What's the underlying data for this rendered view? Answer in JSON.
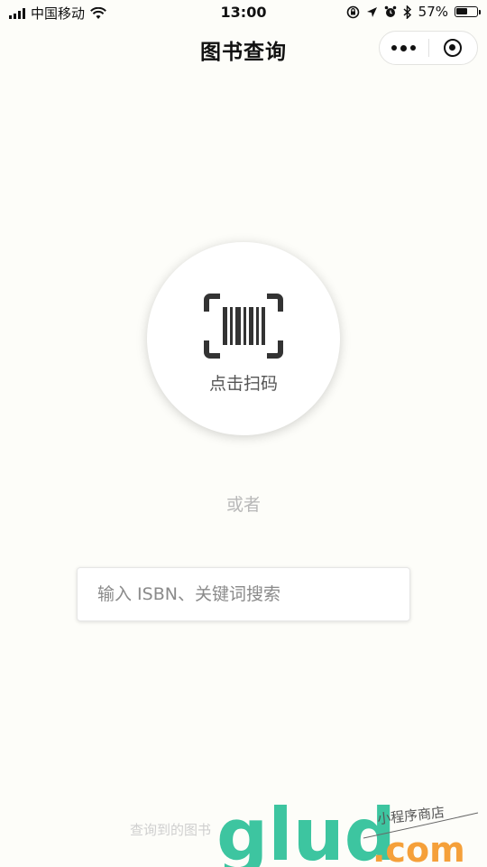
{
  "status_bar": {
    "carrier": "中国移动",
    "time": "13:00",
    "battery": "57%",
    "battery_level": 0.57
  },
  "nav": {
    "title": "图书查询"
  },
  "scan": {
    "label": "点击扫码"
  },
  "divider_text": "或者",
  "search": {
    "placeholder": "输入 ISBN、关键词搜索",
    "value": ""
  },
  "footer_note": "查询到的图书",
  "watermark": {
    "brand": "glud",
    "suffix": ".com",
    "tagline": "小程序商店"
  },
  "colors": {
    "background": "#fdfdf9",
    "watermark_green": "#3dc5a0",
    "watermark_orange": "#f5a03a"
  }
}
